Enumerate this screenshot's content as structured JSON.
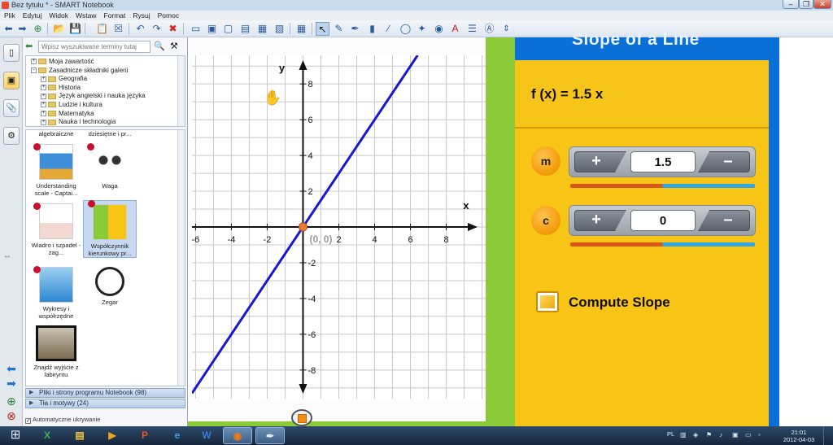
{
  "window": {
    "title": "Bez tytułu * - SMART Notebook",
    "controls": [
      "–",
      "❐",
      "✕"
    ]
  },
  "menu": [
    "Plik",
    "Edytuj",
    "Widok",
    "Wstaw",
    "Format",
    "Rysuj",
    "Pomoc"
  ],
  "gallery": {
    "search_placeholder": "Wpisz wyszukiwane terminy tutaj",
    "tree": [
      {
        "label": "Moja zawartość",
        "level": 0,
        "expander": "+"
      },
      {
        "label": "Zasadnicze składniki galerii",
        "level": 0,
        "expander": "-"
      },
      {
        "label": "Geografia",
        "level": 1,
        "expander": "+"
      },
      {
        "label": "Historia",
        "level": 1,
        "expander": "+"
      },
      {
        "label": "Język angielski i nauka języka",
        "level": 1,
        "expander": "+"
      },
      {
        "label": "Ludzie i kultura",
        "level": 1,
        "expander": "+"
      },
      {
        "label": "Matematyka",
        "level": 1,
        "expander": "+"
      },
      {
        "label": "Nauka i technologia",
        "level": 1,
        "expander": "+"
      }
    ],
    "thumbs_header": [
      "algebraiczne",
      "dziesiętne i pr..."
    ],
    "items": [
      {
        "label": "Understanding scale - Captai...",
        "icon": "poster-thumb"
      },
      {
        "label": "Waga",
        "icon": "scale-thumb"
      },
      {
        "label": "Wiadro i szpadel - zag...",
        "icon": "bucket-thumb"
      },
      {
        "label": "Współczynnik kierunkowy pr...",
        "icon": "slope-thumb"
      },
      {
        "label": "Wykresy i współrzędne",
        "icon": "graph-thumb"
      },
      {
        "label": "Zegar",
        "icon": "clock-thumb"
      },
      {
        "label": "Znajdź wyjście z labiryntu",
        "icon": "maze-thumb"
      }
    ],
    "sections": [
      "Pliki i strony programu Notebook (98)",
      "Tła i motywy (24)"
    ],
    "autohide_label": "Automatyczne ukrywanie"
  },
  "graph": {
    "x_label": "x",
    "y_label": "y",
    "x_ticks": [
      "-6",
      "-4",
      "-2",
      "2",
      "4",
      "6",
      "8"
    ],
    "y_ticks": [
      "8",
      "6",
      "4",
      "2",
      "-2",
      "-4",
      "-6",
      "-8"
    ],
    "origin_label": "(0, 0)",
    "x_range": [
      -6.2,
      10.2
    ],
    "y_range": [
      -9.6,
      9.6
    ],
    "line": {
      "slope": 1.5,
      "intercept": 0,
      "color": "#1616d4"
    },
    "point": {
      "x": 0,
      "y": 0,
      "color": "#f07a3a"
    }
  },
  "panel": {
    "title": "Slope of a Line",
    "function": "f (x) = 1.5 x",
    "m": {
      "label": "m",
      "value": "1.5",
      "plus": "+",
      "minus": "–",
      "level": 0.5
    },
    "c": {
      "label": "c",
      "value": "0",
      "plus": "+",
      "minus": "–",
      "level": 0.5
    },
    "compute_label": "Compute Slope",
    "colors": {
      "blue": "#0a6fd6",
      "yellow": "#f8c416",
      "orange": "#f29a08",
      "green": "#8bcb3a"
    }
  },
  "taskbar": {
    "apps": [
      "excel-icon",
      "folder-icon",
      "media-icon",
      "powerpoint-icon",
      "ie-icon",
      "word-icon",
      "firefox-icon",
      "smart-notebook-icon"
    ],
    "lang": "PL",
    "time": "21:01",
    "date": "2012-04-03"
  }
}
